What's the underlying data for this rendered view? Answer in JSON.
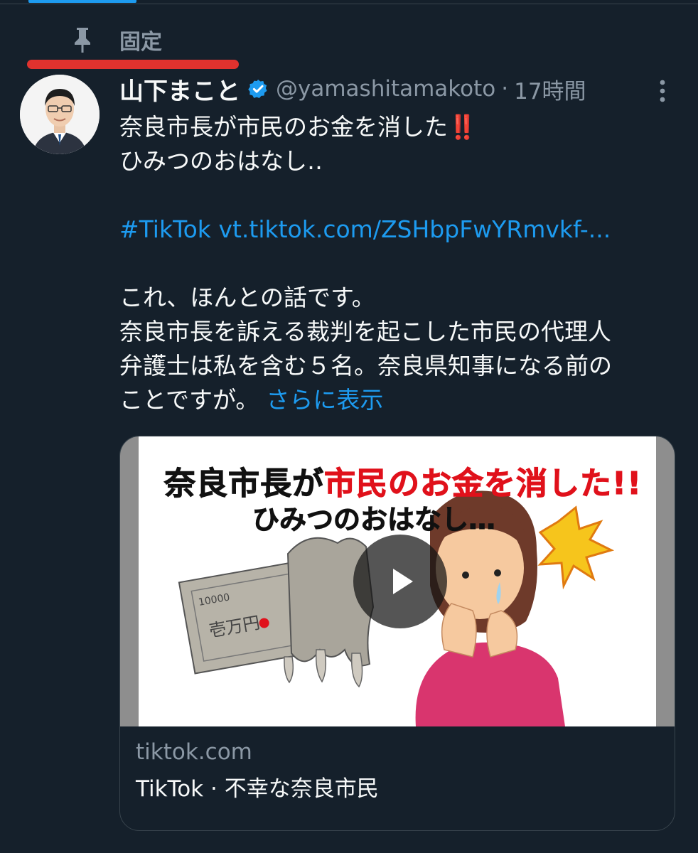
{
  "pinned": {
    "label": "固定",
    "icon": "pin-icon"
  },
  "tweet": {
    "author": {
      "display_name": "山下まこと",
      "handle": "@yamashitamakoto",
      "verified": true
    },
    "separator": "·",
    "timestamp": "17時間",
    "body": {
      "line1_text": "奈良市長が市民のお金を消した",
      "line1_emoji": "‼️",
      "line2": "ひみつのおはなし‥",
      "hashtag": "#TikTok",
      "link": "vt.tiktok.com/ZSHbpFwYRmvkf-...",
      "line3": "これ、ほんとの話です。",
      "line4": "奈良市長を訴える裁判を起こした市民の代理人",
      "line5": "弁護士は私を含む５名。奈良県知事になる前の",
      "line6": "ことですが。",
      "show_more": "さらに表示"
    },
    "card": {
      "thumb_title_black1": "奈良市長が",
      "thumb_title_red": "市民のお金を消した!!",
      "thumb_title2": "ひみつのおはなし…",
      "domain": "tiktok.com",
      "title": "TikTok · 不幸な奈良市民"
    }
  },
  "colors": {
    "background": "#15202b",
    "accent": "#1d9bf0",
    "muted": "#8b98a5",
    "highlight_underline": "#e0322e"
  }
}
